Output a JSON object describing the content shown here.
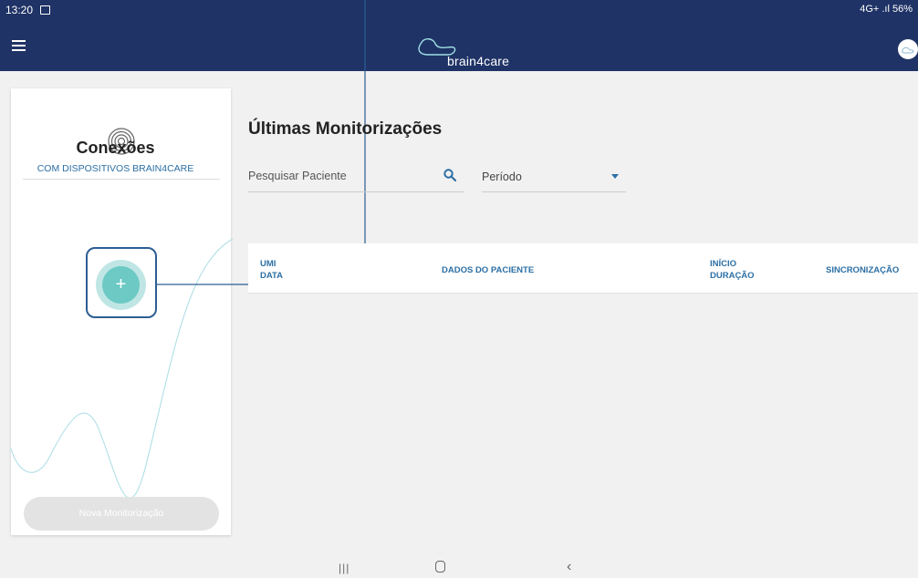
{
  "status_bar": {
    "time": "13:20",
    "signal": "4G+ .ıl 56%"
  },
  "app_bar": {
    "logo_text": "brain4care"
  },
  "connections": {
    "title": "Conexões",
    "subtitle": "COM DISPOSITIVOS BRAIN4CARE",
    "add_symbol": "+"
  },
  "new_monitoring_label": "Nova Monitorização",
  "page_title": "Últimas Monitorizações",
  "search": {
    "placeholder": "Pesquisar Paciente"
  },
  "period": {
    "label": "Período"
  },
  "table": {
    "headers": {
      "umi": "UMI",
      "data": "DATA",
      "dados_paciente": "DADOS DO PACIENTE",
      "inicio": "INÍCIO",
      "duracao": "DURAÇÃO",
      "sincronizacao": "SINCRONIZAÇÃO"
    }
  },
  "colors": {
    "primary": "#1f3366",
    "accent": "#2c6fa5",
    "teal": "#6cc9c4"
  },
  "icons": [
    "menu-icon",
    "brain4care-logo-icon",
    "avatar-icon",
    "connection-signal-icon",
    "search-icon",
    "dropdown-icon",
    "add-icon",
    "nav-recent-icon",
    "nav-home-icon",
    "nav-back-icon"
  ]
}
